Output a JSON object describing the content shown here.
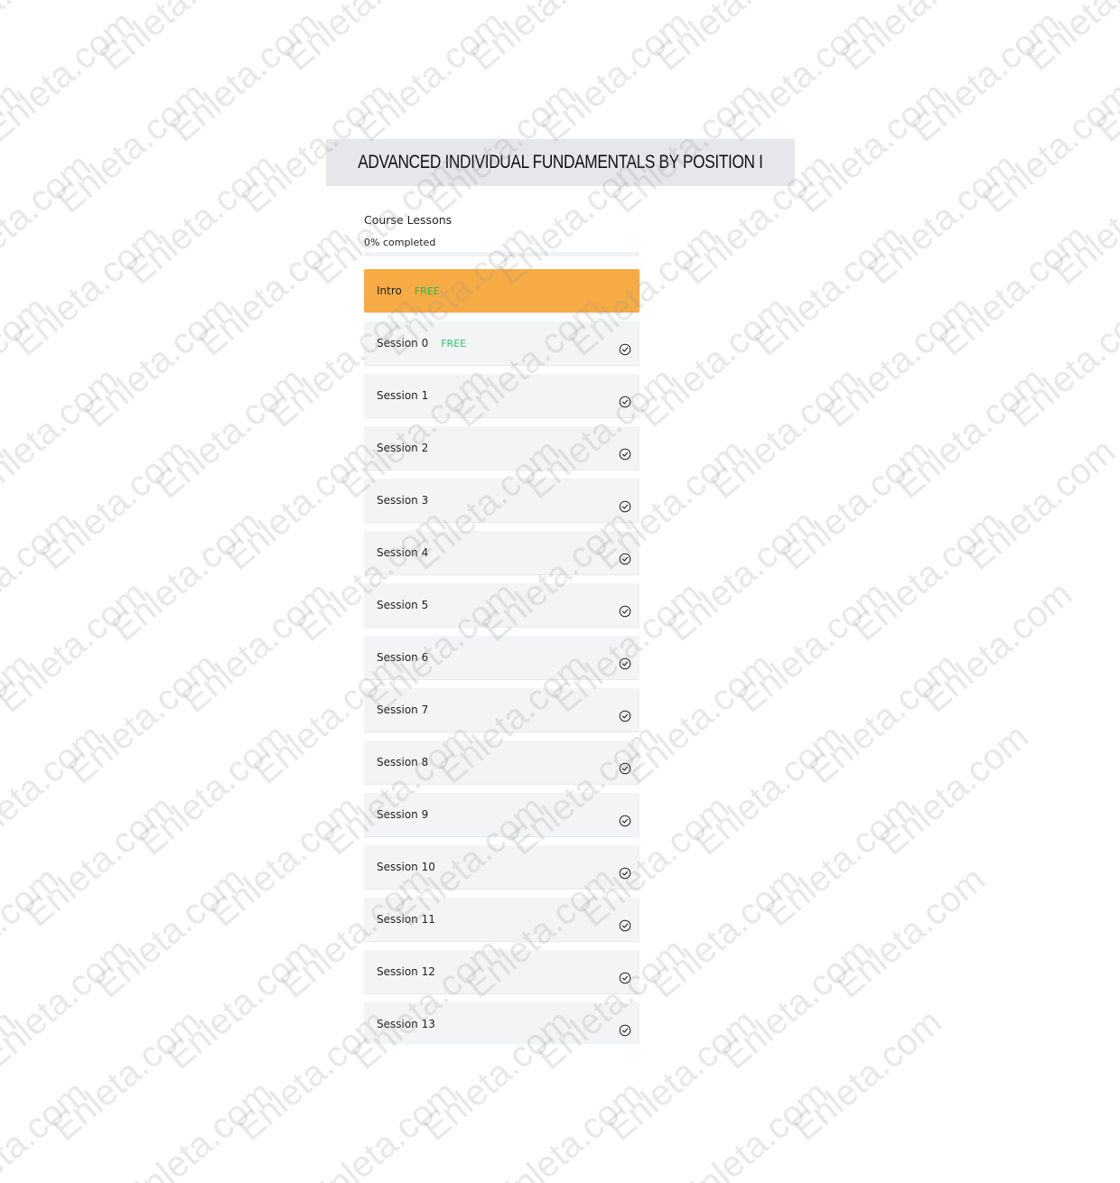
{
  "course": {
    "title": "ADVANCED INDIVIDUAL FUNDAMENTALS BY POSITION I"
  },
  "lessons_panel": {
    "heading": "Course Lessons",
    "progress_text": "0% completed",
    "progress_fraction": 0
  },
  "lessons": [
    {
      "label": "Intro",
      "badge": "FREE",
      "active": true,
      "icon": null
    },
    {
      "label": "Session 0",
      "badge": "FREE",
      "active": false,
      "icon": "check-circle-icon"
    },
    {
      "label": "Session 1",
      "badge": null,
      "active": false,
      "icon": "check-circle-icon"
    },
    {
      "label": "Session 2",
      "badge": null,
      "active": false,
      "icon": "check-circle-icon"
    },
    {
      "label": "Session 3",
      "badge": null,
      "active": false,
      "icon": "check-circle-icon"
    },
    {
      "label": "Session 4",
      "badge": null,
      "active": false,
      "icon": "check-circle-icon"
    },
    {
      "label": "Session 5",
      "badge": null,
      "active": false,
      "icon": "check-circle-icon"
    },
    {
      "label": "Session 6",
      "badge": null,
      "active": false,
      "icon": "check-circle-icon"
    },
    {
      "label": "Session 7",
      "badge": null,
      "active": false,
      "icon": "check-circle-icon"
    },
    {
      "label": "Session 8",
      "badge": null,
      "active": false,
      "icon": "check-circle-icon"
    },
    {
      "label": "Session 9",
      "badge": null,
      "active": false,
      "icon": "check-circle-icon"
    },
    {
      "label": "Session 10",
      "badge": null,
      "active": false,
      "icon": "check-circle-icon"
    },
    {
      "label": "Session 11",
      "badge": null,
      "active": false,
      "icon": "check-circle-icon"
    },
    {
      "label": "Session 12",
      "badge": null,
      "active": false,
      "icon": "check-circle-icon"
    },
    {
      "label": "Session 13",
      "badge": null,
      "active": false,
      "icon": "check-circle-icon"
    }
  ],
  "colors": {
    "active_lesson": "#f7ab45",
    "free_badge": "#2ec26a",
    "title_bar": "#e6e7ea",
    "lesson_bg": "#f3f4f5"
  },
  "watermark": {
    "text": "Enleta.com"
  }
}
